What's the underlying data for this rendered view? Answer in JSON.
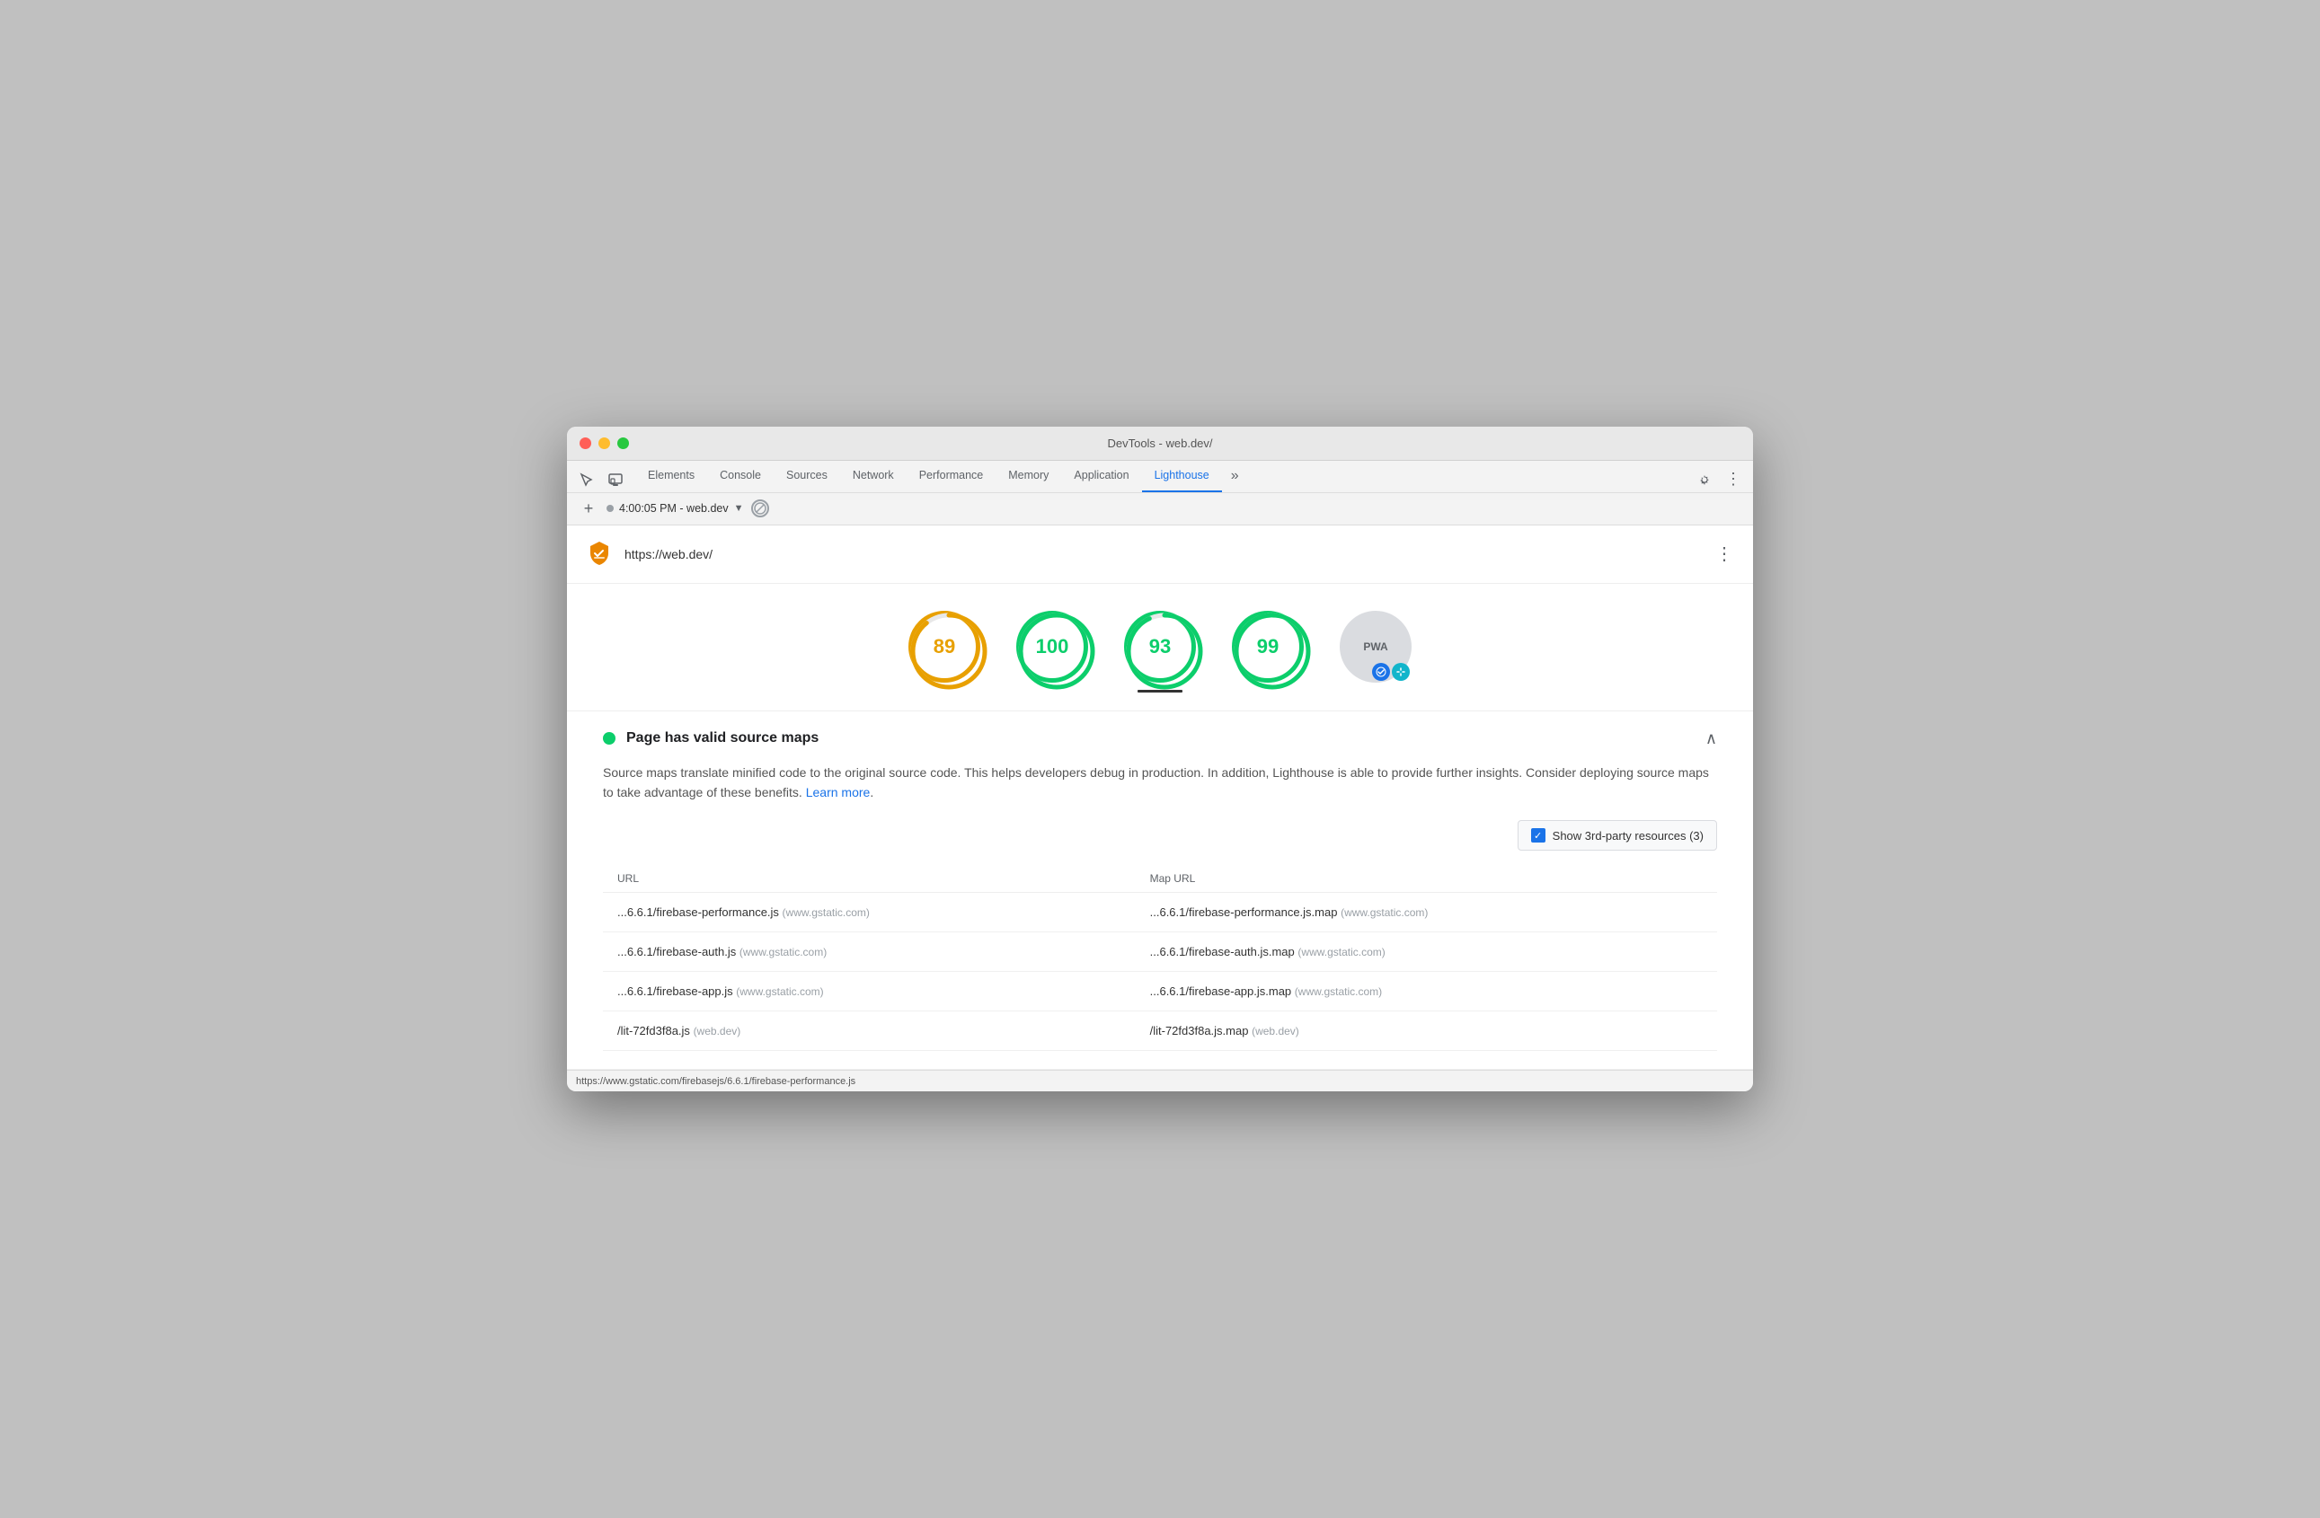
{
  "window": {
    "title": "DevTools - web.dev/"
  },
  "tabs": [
    {
      "id": "elements",
      "label": "Elements",
      "active": false
    },
    {
      "id": "console",
      "label": "Console",
      "active": false
    },
    {
      "id": "sources",
      "label": "Sources",
      "active": false
    },
    {
      "id": "network",
      "label": "Network",
      "active": false
    },
    {
      "id": "performance",
      "label": "Performance",
      "active": false
    },
    {
      "id": "memory",
      "label": "Memory",
      "active": false
    },
    {
      "id": "application",
      "label": "Application",
      "active": false
    },
    {
      "id": "lighthouse",
      "label": "Lighthouse",
      "active": true
    }
  ],
  "session": {
    "label": "4:00:05 PM - web.dev"
  },
  "lighthouse": {
    "url": "https://web.dev/",
    "scores": [
      {
        "value": "89",
        "color": "orange",
        "active": false
      },
      {
        "value": "100",
        "color": "green",
        "active": false
      },
      {
        "value": "93",
        "color": "green",
        "active": true
      },
      {
        "value": "99",
        "color": "green",
        "active": false
      }
    ],
    "pwa_label": "PWA",
    "audit": {
      "title": "Page has valid source maps",
      "dot_color": "#0cce6b",
      "description_part1": "Source maps translate minified code to the original source code. This helps developers debug in production. In addition, Lighthouse is able to provide further insights. Consider deploying source maps to take advantage of these benefits. ",
      "learn_more_text": "Learn more",
      "description_part2": ".",
      "third_party_label": "Show 3rd-party resources (3)",
      "table": {
        "headers": [
          "URL",
          "Map URL"
        ],
        "rows": [
          {
            "url": "...6.6.1/firebase-performance.js",
            "url_domain": "(www.gstatic.com)",
            "map_url": "...6.6.1/firebase-performance.js.map",
            "map_domain": "(www.gstatic.com)"
          },
          {
            "url": "...6.6.1/firebase-auth.js",
            "url_domain": "(www.gstatic.com)",
            "map_url": "...6.6.1/firebase-auth.js.map",
            "map_domain": "(www.gstatic.com)"
          },
          {
            "url": "...6.6.1/firebase-app.js",
            "url_domain": "(www.gstatic.com)",
            "map_url": "...6.6.1/firebase-app.js.map",
            "map_domain": "(www.gstatic.com)"
          },
          {
            "url": "/lit-72fd3f8a.js",
            "url_domain": "(web.dev)",
            "map_url": "/lit-72fd3f8a.js.map",
            "map_domain": "(web.dev)"
          }
        ]
      }
    }
  },
  "status_bar": {
    "url": "https://www.gstatic.com/firebasejs/6.6.1/firebase-performance.js"
  },
  "icons": {
    "cursor": "⬡",
    "layers": "⧉",
    "gear": "⚙",
    "more_vert": "⋮",
    "more_horiz": "⋯",
    "chevron_up": "∧",
    "chevron_down": "∨",
    "check": "✓",
    "no_throttle": "⊘"
  }
}
